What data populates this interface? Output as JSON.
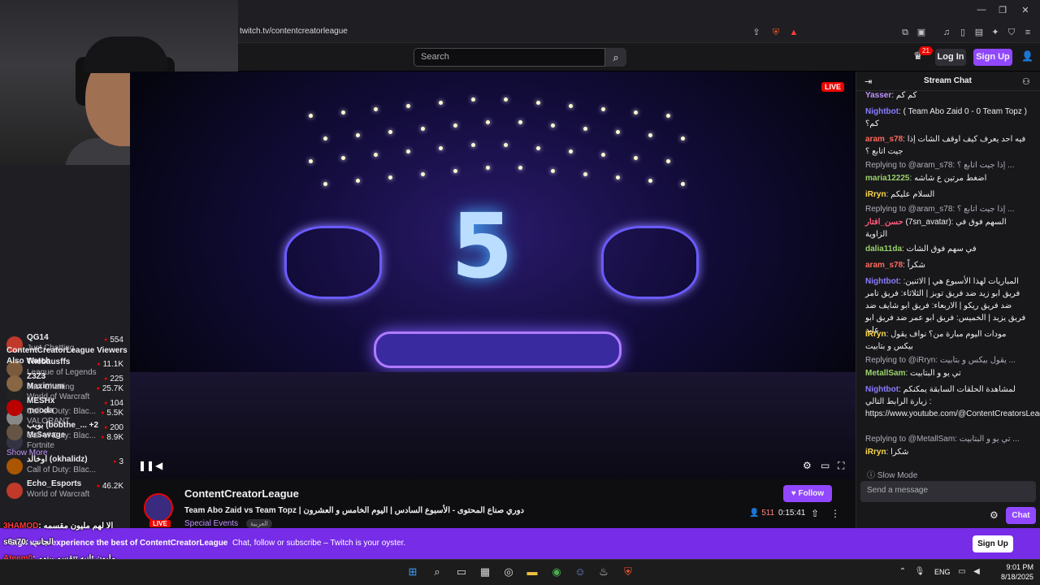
{
  "browser": {
    "url": "twitch.tv/contentcreatorleague",
    "brave_badge": "2"
  },
  "topbar": {
    "search_placeholder": "Search",
    "notif_count": "21",
    "login_label": "Log In",
    "signup_label": "Sign Up"
  },
  "sidebar": {
    "channels": [
      {
        "name": "QG14",
        "game": "Just Chatting",
        "viewers": "554",
        "color": "#c0392b"
      },
      {
        "name": "Thebausffs",
        "game": "League of Legends",
        "viewers": "11.1K",
        "color": "#7a5a3a"
      },
      {
        "name": "Maximum",
        "game": "World of Warcraft",
        "viewers": "25.7K",
        "color": "#222"
      },
      {
        "name": "mooda",
        "game": "VALORANT",
        "viewers": "5.5K",
        "color": "#888"
      },
      {
        "name": "MrSavage",
        "game": "Fortnite",
        "viewers": "8.9K",
        "color": "#334"
      },
      {
        "name": "أوخالد (okhalidz)",
        "game": "Call of Duty: Blac...",
        "viewers": "3",
        "color": "#aa5500"
      },
      {
        "name": "Echo_Esports",
        "game": "World of Warcraft",
        "viewers": "46.2K",
        "color": "#c0392b"
      }
    ],
    "also_watch_title": "ContentCreatorLeague Viewers Also Watch",
    "also_watch": [
      {
        "name": "Z3Z3",
        "game": "Just Chatting",
        "viewers": "225",
        "color": "#886644"
      },
      {
        "name": "MESHx",
        "game": "Call of Duty: Blac...",
        "viewers": "104",
        "color": "#b00"
      },
      {
        "name": "بوبب (bobthe_... +2",
        "game": "Call of Duty: Blac...",
        "viewers": "200",
        "color": "#654"
      }
    ],
    "show_more": "Show More"
  },
  "player": {
    "live_label": "LIVE",
    "center_numeral": "5"
  },
  "stream": {
    "streamer": "ContentCreatorLeague",
    "title": "Team Abo Zaid vs Team Topz | دوري صناع المحتوى - الأسبوع السادس | اليوم الخامس و العشرون",
    "category": "Special Events",
    "language_tag": "العربية",
    "live_label": "LIVE",
    "follow_label": "Follow",
    "viewers": "511",
    "uptime": "0:15:41"
  },
  "chat": {
    "header": "Stream Chat",
    "messages": [
      {
        "nick": "Yasser",
        "color": "#bf94ff",
        "text": ": كم كم"
      },
      {
        "nick": "Nightbot",
        "color": "#8a7cff",
        "text": ": ( Team Abo Zaid 0 - 0 Team Topz ) كم؟"
      },
      {
        "nick": "aram_s78",
        "color": "#ff6a5a",
        "text": ": فيه احد يعرف كيف اوقف الشات إذا جيت اتابع ؟"
      },
      {
        "reply": "Replying to @aram_s78: إذا جيت اتابع ؟ ..."
      },
      {
        "nick": "maria12225",
        "color": "#9bd36b",
        "text": ": اضغط مرتين ع شاشه"
      },
      {
        "nick": "iRryn",
        "color": "#ffd84a",
        "text": ": السلام عليكم"
      },
      {
        "reply": "Replying to @aram_s78: إذا جيت اتابع ؟ ..."
      },
      {
        "nick": "حسن_افتار",
        "color": "#ff5a7a",
        "text": " (7sn_avatar): السهم فوق في الزاوية"
      },
      {
        "nick": "dalia11da",
        "color": "#9bd36b",
        "text": ": في سهم فوق الشات"
      },
      {
        "nick": "aram_s78",
        "color": "#ff6a5a",
        "text": ": شكراً"
      },
      {
        "nick": "Nightbot",
        "color": "#8a7cff",
        "text": ": المباريات لهذا الأسبوع هي | الاثنين: فريق ابو زيد ضد فريق توبز | الثلاثاء: فريق تامر ضد فريق ريكو | الاربعاء: فريق ابو شايف ضد فريق يزيد | الخميس: فريق ابو عمر ضد فريق ابو عابد"
      },
      {
        "nick": "iRryn",
        "color": "#ffd84a",
        "text": ": مودات اليوم مبارة من؟ نواف يقول بيكس و بتابيت"
      },
      {
        "reply": "Replying to @iRryn: يقول بيكس و بتابيت ..."
      },
      {
        "nick": "MetallSam",
        "color": "#9bd36b",
        "text": ": تي يو و البتابيت"
      },
      {
        "nick": "Nightbot",
        "color": "#8a7cff",
        "text": ": لمشاهدة الحلقات السابقة يمكنكم زيارة الرابط التالي : https://www.youtube.com/@ContentCreatorsLeague"
      },
      {
        "reply": "Replying to @MetallSam: تي يو و البتابيت ..."
      },
      {
        "nick": "iRryn",
        "color": "#ffd84a",
        "text": ": شكرا"
      }
    ],
    "slow_mode": "Slow Mode",
    "input_placeholder": "Send a message",
    "chat_button": "Chat"
  },
  "banner": {
    "text_bold": "Sign up to experience the best of ContentCreatorLeague",
    "text": "Chat, follow or subscribe – Twitch is your oyster.",
    "signup_label": "Sign Up"
  },
  "overlay_chat": [
    {
      "nick": "3HAMOD",
      "color": "#ff3b3b",
      "text": ": الا لهم مليون مقسمه"
    },
    {
      "nick": "s6a70",
      "color": "#ffffff",
      "text": ": الجانب"
    },
    {
      "nick": "Ateem0",
      "color": "#ff3b3b",
      "text": ": مليون ثانيه تتقسم بينهم"
    },
    {
      "nick": "sultan0273",
      "color": "#ffffff",
      "text": ": 1,000,000 الا يعطو هم"
    }
  ],
  "taskbar": {
    "language": "ENG",
    "time": "9:01 PM",
    "date": "8/18/2025"
  }
}
